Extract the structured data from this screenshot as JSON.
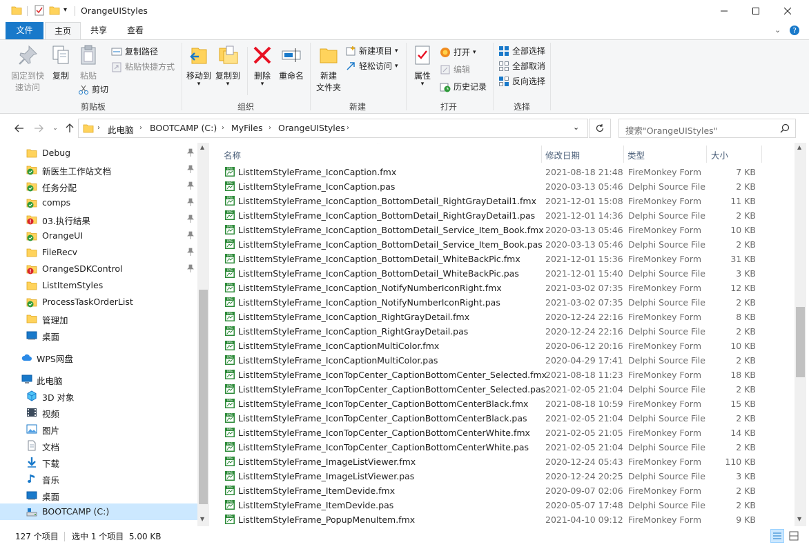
{
  "window": {
    "title": "OrangeUIStyles",
    "colors": {
      "accent": "#1979ca",
      "selection": "#cce8ff",
      "folder": "#ffd35c",
      "file_icon": "#2e8b3a"
    }
  },
  "ribbon_tabs": [
    {
      "label": "文件"
    },
    {
      "label": "主页"
    },
    {
      "label": "共享"
    },
    {
      "label": "查看"
    }
  ],
  "ribbon": {
    "clipboard": {
      "group_label": "剪贴板",
      "pin_label_1": "固定到快",
      "pin_label_2": "速访问",
      "copy_label": "复制",
      "paste_label": "粘贴",
      "copy_path_label": "复制路径",
      "paste_shortcut_label": "粘贴快捷方式",
      "cut_label": "剪切"
    },
    "organize": {
      "group_label": "组织",
      "move_to_label": "移动到",
      "copy_to_label": "复制到",
      "delete_label": "删除",
      "rename_label": "重命名"
    },
    "new": {
      "group_label": "新建",
      "new_folder_label_1": "新建",
      "new_folder_label_2": "文件夹",
      "new_item_label": "新建项目",
      "easy_access_label": "轻松访问"
    },
    "open": {
      "group_label": "打开",
      "properties_label": "属性",
      "open_label": "打开",
      "edit_label": "编辑",
      "history_label": "历史记录"
    },
    "select": {
      "group_label": "选择",
      "select_all_label": "全部选择",
      "select_none_label": "全部取消",
      "invert_label": "反向选择"
    }
  },
  "address": {
    "crumbs": [
      "此电脑",
      "BOOTCAMP (C:)",
      "MyFiles",
      "OrangeUIStyles"
    ],
    "search_placeholder": "搜索\"OrangeUIStyles\""
  },
  "nav": {
    "quick_access": [
      {
        "label": "Debug",
        "icon": "folder-icon",
        "pinned": true
      },
      {
        "label": "新医生工作站文档",
        "icon": "sync-folder-icon",
        "pinned": true
      },
      {
        "label": "任务分配",
        "icon": "sync-folder-icon",
        "pinned": true
      },
      {
        "label": "comps",
        "icon": "sync-folder-icon",
        "pinned": true
      },
      {
        "label": "03.执行结果",
        "icon": "sync-error-folder-icon",
        "pinned": true
      },
      {
        "label": "OrangeUI",
        "icon": "sync-folder-icon",
        "pinned": true
      },
      {
        "label": "FileRecv",
        "icon": "folder-icon",
        "pinned": true
      },
      {
        "label": "OrangeSDKControl",
        "icon": "sync-error-folder-icon",
        "pinned": true
      },
      {
        "label": "ListItemStyles",
        "icon": "folder-icon",
        "pinned": false
      },
      {
        "label": "ProcessTaskOrderList",
        "icon": "sync-folder-icon",
        "pinned": false
      },
      {
        "label": "管理加",
        "icon": "folder-icon",
        "pinned": false
      },
      {
        "label": "桌面",
        "icon": "desktop-icon",
        "pinned": false
      }
    ],
    "wps_label": "WPS网盘",
    "this_pc_label": "此电脑",
    "this_pc_items": [
      {
        "label": "3D 对象",
        "icon": "3d-objects-icon"
      },
      {
        "label": "视频",
        "icon": "video-icon"
      },
      {
        "label": "图片",
        "icon": "pictures-icon"
      },
      {
        "label": "文档",
        "icon": "documents-icon"
      },
      {
        "label": "下载",
        "icon": "download-icon"
      },
      {
        "label": "音乐",
        "icon": "music-icon"
      },
      {
        "label": "桌面",
        "icon": "desktop-icon"
      },
      {
        "label": "BOOTCAMP (C:)",
        "icon": "drive-icon"
      }
    ]
  },
  "columns": {
    "name": "名称",
    "date": "修改日期",
    "type": "类型",
    "size": "大小"
  },
  "files": [
    {
      "name": "ListItemStyleFrame_IconCaption.fmx",
      "date": "2021-08-18 21:48",
      "type": "FireMonkey Form",
      "size": "7 KB"
    },
    {
      "name": "ListItemStyleFrame_IconCaption.pas",
      "date": "2020-03-13 05:46",
      "type": "Delphi Source File",
      "size": "2 KB"
    },
    {
      "name": "ListItemStyleFrame_IconCaption_BottomDetail_RightGrayDetail1.fmx",
      "date": "2021-12-01 15:08",
      "type": "FireMonkey Form",
      "size": "11 KB"
    },
    {
      "name": "ListItemStyleFrame_IconCaption_BottomDetail_RightGrayDetail1.pas",
      "date": "2021-12-01 14:36",
      "type": "Delphi Source File",
      "size": "2 KB"
    },
    {
      "name": "ListItemStyleFrame_IconCaption_BottomDetail_Service_Item_Book.fmx",
      "date": "2020-03-13 05:46",
      "type": "FireMonkey Form",
      "size": "10 KB"
    },
    {
      "name": "ListItemStyleFrame_IconCaption_BottomDetail_Service_Item_Book.pas",
      "date": "2020-03-13 05:46",
      "type": "Delphi Source File",
      "size": "2 KB"
    },
    {
      "name": "ListItemStyleFrame_IconCaption_BottomDetail_WhiteBackPic.fmx",
      "date": "2021-12-01 15:36",
      "type": "FireMonkey Form",
      "size": "31 KB"
    },
    {
      "name": "ListItemStyleFrame_IconCaption_BottomDetail_WhiteBackPic.pas",
      "date": "2021-12-01 15:40",
      "type": "Delphi Source File",
      "size": "3 KB"
    },
    {
      "name": "ListItemStyleFrame_IconCaption_NotifyNumberIconRight.fmx",
      "date": "2021-03-02 07:35",
      "type": "FireMonkey Form",
      "size": "12 KB"
    },
    {
      "name": "ListItemStyleFrame_IconCaption_NotifyNumberIconRight.pas",
      "date": "2021-03-02 07:35",
      "type": "Delphi Source File",
      "size": "2 KB"
    },
    {
      "name": "ListItemStyleFrame_IconCaption_RightGrayDetail.fmx",
      "date": "2020-12-24 22:16",
      "type": "FireMonkey Form",
      "size": "8 KB"
    },
    {
      "name": "ListItemStyleFrame_IconCaption_RightGrayDetail.pas",
      "date": "2020-12-24 22:16",
      "type": "Delphi Source File",
      "size": "2 KB"
    },
    {
      "name": "ListItemStyleFrame_IconCaptionMultiColor.fmx",
      "date": "2020-06-12 20:16",
      "type": "FireMonkey Form",
      "size": "10 KB"
    },
    {
      "name": "ListItemStyleFrame_IconCaptionMultiColor.pas",
      "date": "2020-04-29 17:41",
      "type": "Delphi Source File",
      "size": "2 KB"
    },
    {
      "name": "ListItemStyleFrame_IconTopCenter_CaptionBottomCenter_Selected.fmx",
      "date": "2021-08-18 11:23",
      "type": "FireMonkey Form",
      "size": "18 KB"
    },
    {
      "name": "ListItemStyleFrame_IconTopCenter_CaptionBottomCenter_Selected.pas",
      "date": "2021-02-05 21:04",
      "type": "Delphi Source File",
      "size": "2 KB"
    },
    {
      "name": "ListItemStyleFrame_IconTopCenter_CaptionBottomCenterBlack.fmx",
      "date": "2021-08-18 10:59",
      "type": "FireMonkey Form",
      "size": "15 KB"
    },
    {
      "name": "ListItemStyleFrame_IconTopCenter_CaptionBottomCenterBlack.pas",
      "date": "2021-02-05 21:04",
      "type": "Delphi Source File",
      "size": "2 KB"
    },
    {
      "name": "ListItemStyleFrame_IconTopCenter_CaptionBottomCenterWhite.fmx",
      "date": "2021-02-05 21:05",
      "type": "FireMonkey Form",
      "size": "14 KB"
    },
    {
      "name": "ListItemStyleFrame_IconTopCenter_CaptionBottomCenterWhite.pas",
      "date": "2021-02-05 21:04",
      "type": "Delphi Source File",
      "size": "2 KB"
    },
    {
      "name": "ListItemStyleFrame_ImageListViewer.fmx",
      "date": "2020-12-24 05:43",
      "type": "FireMonkey Form",
      "size": "110 KB"
    },
    {
      "name": "ListItemStyleFrame_ImageListViewer.pas",
      "date": "2020-12-24 20:25",
      "type": "Delphi Source File",
      "size": "3 KB"
    },
    {
      "name": "ListItemStyleFrame_ItemDevide.fmx",
      "date": "2020-09-07 02:06",
      "type": "FireMonkey Form",
      "size": "2 KB"
    },
    {
      "name": "ListItemStyleFrame_ItemDevide.pas",
      "date": "2020-05-07 17:48",
      "type": "Delphi Source File",
      "size": "2 KB"
    },
    {
      "name": "ListItemStyleFrame_PopupMenuItem.fmx",
      "date": "2021-04-10 09:12",
      "type": "FireMonkey Form",
      "size": "9 KB"
    }
  ],
  "status": {
    "item_count": "127 个项目",
    "selection": "选中 1 个项目  5.00 KB"
  }
}
